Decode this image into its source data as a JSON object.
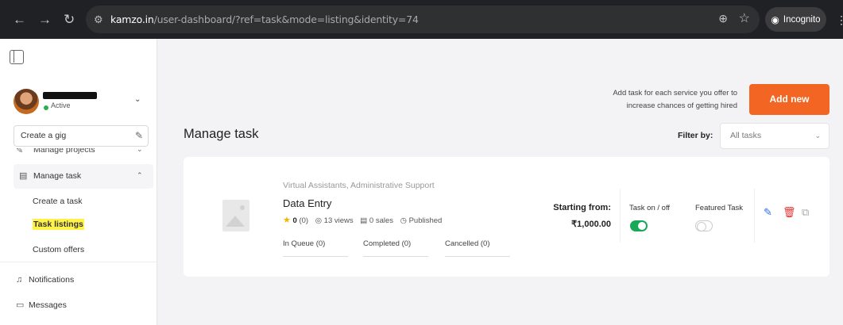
{
  "browser": {
    "url_host": "kamzo.in",
    "url_path": "/user-dashboard/?ref=task&mode=listing&identity=74",
    "incognito_label": "Incognito"
  },
  "sidebar": {
    "profile_status": "Active",
    "create_gig_label": "Create a gig",
    "menu": {
      "manage_projects": "Manage projects",
      "manage_task": "Manage task",
      "sub_items": [
        "Create a task",
        "Task listings",
        "Custom offers"
      ],
      "notifications": "Notifications",
      "messages": "Messages"
    },
    "active_item": "Task listings",
    "highlight_color": "#fff34a"
  },
  "header": {
    "add_info": "Add task for each service you offer to increase chances of getting hired",
    "add_button": "Add new",
    "accent_color": "#f26522"
  },
  "main": {
    "title": "Manage task",
    "filter_label": "Filter by:",
    "filter_value": "All tasks"
  },
  "task": {
    "category": "Virtual Assistants, Administrative Support",
    "title": "Data Entry",
    "rating": "0",
    "reviews": "(0)",
    "views": "13 views",
    "sales": "0 sales",
    "status": "Published",
    "queue": [
      "In Queue (0)",
      "Completed (0)",
      "Cancelled (0)"
    ],
    "starting_label": "Starting from:",
    "price": "₹1,000.00",
    "task_toggle_label": "Task on / off",
    "task_toggle_on": true,
    "featured_label": "Featured Task",
    "featured_on": false
  }
}
